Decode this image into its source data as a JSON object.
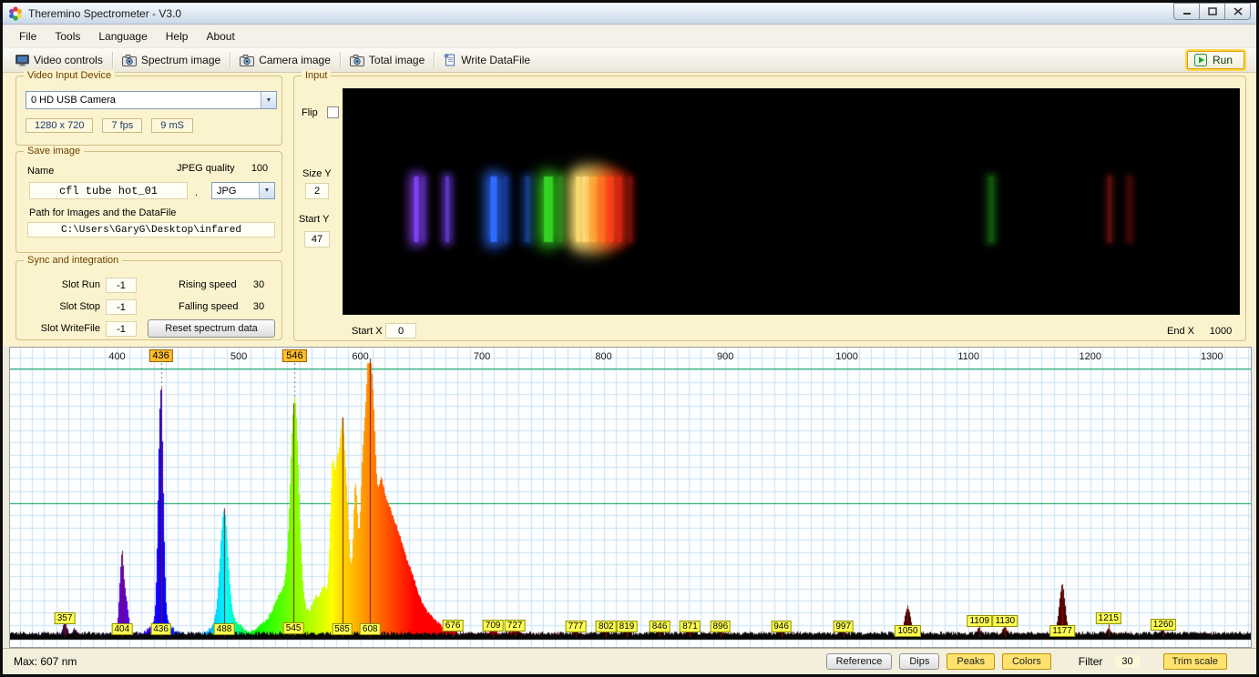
{
  "window": {
    "title": "Theremino Spectrometer - V3.0",
    "controls": [
      "minimize",
      "maximize",
      "close"
    ]
  },
  "menu": {
    "items": [
      "File",
      "Tools",
      "Language",
      "Help",
      "About"
    ]
  },
  "toolbar": {
    "items": [
      {
        "label": "Video controls",
        "icon": "video-controls-icon"
      },
      {
        "label": "Spectrum image",
        "icon": "camera-icon"
      },
      {
        "label": "Camera image",
        "icon": "camera-icon"
      },
      {
        "label": "Total image",
        "icon": "camera-icon"
      },
      {
        "label": "Write DataFile",
        "icon": "write-datafile-icon"
      }
    ],
    "run_label": "Run"
  },
  "video_input": {
    "caption": "Video Input Device",
    "device": "0 HD USB Camera",
    "stats": [
      "1280 x 720",
      "7 fps",
      "9 mS"
    ]
  },
  "save_image": {
    "caption": "Save image",
    "name_label": "Name",
    "name_value": "cfl tube hot_01",
    "separator": ".",
    "format_value": "JPG",
    "jpeg_quality_label": "JPEG quality",
    "jpeg_quality_value": "100",
    "path_label": "Path for Images and the DataFile",
    "path_value": "C:\\Users\\GaryG\\Desktop\\infared"
  },
  "sync": {
    "caption": "Sync and integration",
    "slots": [
      {
        "label": "Slot Run",
        "value": "-1"
      },
      {
        "label": "Slot Stop",
        "value": "-1"
      },
      {
        "label": "Slot WriteFile",
        "value": "-1"
      }
    ],
    "rising_label": "Rising speed",
    "rising_value": "30",
    "falling_label": "Falling speed",
    "falling_value": "30",
    "reset_button": "Reset spectrum data"
  },
  "input_panel": {
    "caption": "Input",
    "flip_label": "Flip",
    "size_y_label": "Size Y",
    "size_y_value": "2",
    "start_y_label": "Start Y",
    "start_y_value": "47",
    "start_x_label": "Start X",
    "start_x_value": "0",
    "end_x_label": "End X",
    "end_x_value": "1000",
    "spectral_lines": [
      {
        "pos": 0.081,
        "w": 5,
        "color": "#8a45ff",
        "glow": 12,
        "o": 0.95
      },
      {
        "pos": 0.09,
        "w": 3,
        "color": "#6a35d8",
        "glow": 7,
        "o": 0.55
      },
      {
        "pos": 0.116,
        "w": 4,
        "color": "#7540f0",
        "glow": 9,
        "o": 0.8
      },
      {
        "pos": 0.168,
        "w": 7,
        "color": "#2e6bff",
        "glow": 14,
        "o": 1
      },
      {
        "pos": 0.181,
        "w": 4,
        "color": "#1d50cc",
        "glow": 8,
        "o": 0.55
      },
      {
        "pos": 0.206,
        "w": 5,
        "color": "#2457e0",
        "glow": 9,
        "o": 0.6
      },
      {
        "pos": 0.229,
        "w": 10,
        "color": "#34d422",
        "glow": 16,
        "o": 1
      },
      {
        "pos": 0.242,
        "w": 5,
        "color": "#2aa51a",
        "glow": 9,
        "o": 0.55
      },
      {
        "pos": 0.262,
        "w": 6,
        "color": "#ffdf45",
        "glow": 14,
        "o": 0.9
      },
      {
        "pos": 0.271,
        "w": 8,
        "color": "#fff2a8",
        "glow": 20,
        "o": 1
      },
      {
        "pos": 0.28,
        "w": 8,
        "color": "#ffc24a",
        "glow": 20,
        "o": 1
      },
      {
        "pos": 0.289,
        "w": 7,
        "color": "#ff8a24",
        "glow": 16,
        "o": 1
      },
      {
        "pos": 0.298,
        "w": 7,
        "color": "#ff4a18",
        "glow": 16,
        "o": 1
      },
      {
        "pos": 0.308,
        "w": 5,
        "color": "#e22512",
        "glow": 11,
        "o": 0.85
      },
      {
        "pos": 0.32,
        "w": 4,
        "color": "#a3150c",
        "glow": 7,
        "o": 0.6
      },
      {
        "pos": 0.723,
        "w": 5,
        "color": "#22a51a",
        "glow": 8,
        "o": 0.5
      },
      {
        "pos": 0.856,
        "w": 4,
        "color": "#b01c1c",
        "glow": 7,
        "o": 0.5
      },
      {
        "pos": 0.878,
        "w": 6,
        "color": "#7d1212",
        "glow": 7,
        "o": 0.45
      }
    ]
  },
  "chart_data": {
    "type": "area",
    "description": "CFL lamp emission spectrum, intensity vs wavelength (nm), rainbow-filled peaks",
    "x_range_nm": [
      312,
      1332
    ],
    "ylim": [
      0,
      1.05
    ],
    "grid": true,
    "grid_nm_step": 10,
    "reference_lines_pct": [
      100,
      50
    ],
    "top_ticks": [
      400,
      500,
      600,
      700,
      800,
      900,
      1000,
      1100,
      1200,
      1300
    ],
    "calibration_ticks": [
      436,
      546
    ],
    "max_peak_nm": 607,
    "peaks": [
      [
        357,
        0.045,
        1.6
      ],
      [
        365,
        0.02,
        1.5
      ],
      [
        404,
        0.3,
        1.8
      ],
      [
        408,
        0.1,
        1.6
      ],
      [
        436,
        0.85,
        2.0
      ],
      [
        436,
        0.06,
        7
      ],
      [
        488,
        0.4,
        3.2
      ],
      [
        488,
        0.06,
        8
      ],
      [
        500,
        0.02,
        6
      ],
      [
        520,
        0.03,
        5
      ],
      [
        533,
        0.1,
        6
      ],
      [
        546,
        0.74,
        3.4
      ],
      [
        546,
        0.13,
        9
      ],
      [
        563,
        0.08,
        3
      ],
      [
        570,
        0.1,
        3
      ],
      [
        577,
        0.5,
        1.8
      ],
      [
        581,
        0.42,
        1.8
      ],
      [
        585,
        0.58,
        2.0
      ],
      [
        589,
        0.35,
        2.2
      ],
      [
        583,
        0.12,
        12
      ],
      [
        596,
        0.48,
        1.8
      ],
      [
        602,
        0.55,
        2.2
      ],
      [
        607,
        0.95,
        2.4
      ],
      [
        611,
        0.5,
        2.0
      ],
      [
        616,
        0.42,
        3.0
      ],
      [
        622,
        0.36,
        4
      ],
      [
        630,
        0.3,
        5
      ],
      [
        640,
        0.2,
        6
      ],
      [
        652,
        0.08,
        7
      ],
      [
        665,
        0.025,
        6
      ],
      [
        676,
        0.035,
        2
      ],
      [
        709,
        0.026,
        2
      ],
      [
        727,
        0.03,
        2
      ],
      [
        777,
        0.016,
        2
      ],
      [
        802,
        0.022,
        2
      ],
      [
        819,
        0.022,
        2
      ],
      [
        846,
        0.02,
        2
      ],
      [
        871,
        0.018,
        2
      ],
      [
        896,
        0.018,
        2
      ],
      [
        946,
        0.016,
        2
      ],
      [
        997,
        0.016,
        2
      ],
      [
        1050,
        0.1,
        2.4
      ],
      [
        1109,
        0.02,
        2
      ],
      [
        1130,
        0.026,
        2
      ],
      [
        1177,
        0.18,
        2.4
      ],
      [
        1215,
        0.018,
        2
      ],
      [
        1260,
        0.014,
        2
      ]
    ],
    "peak_labels": [
      [
        357,
        20
      ],
      [
        404,
        8
      ],
      [
        436,
        8
      ],
      [
        488,
        8
      ],
      [
        545,
        9
      ],
      [
        585,
        8
      ],
      [
        608,
        8
      ],
      [
        676,
        12
      ],
      [
        709,
        12
      ],
      [
        727,
        12
      ],
      [
        777,
        11
      ],
      [
        802,
        11
      ],
      [
        819,
        11
      ],
      [
        846,
        11
      ],
      [
        871,
        11
      ],
      [
        896,
        11
      ],
      [
        946,
        11
      ],
      [
        997,
        11
      ],
      [
        1050,
        6
      ],
      [
        1109,
        17
      ],
      [
        1130,
        17
      ],
      [
        1177,
        6
      ],
      [
        1215,
        20
      ],
      [
        1260,
        13
      ]
    ]
  },
  "statusbar": {
    "max_label": "Max: 607 nm",
    "buttons": [
      {
        "label": "Reference",
        "style": "gray"
      },
      {
        "label": "Dips",
        "style": "gray"
      },
      {
        "label": "Peaks",
        "style": "yellow"
      },
      {
        "label": "Colors",
        "style": "yellow"
      }
    ],
    "filter_label": "Filter",
    "filter_value": "30",
    "trim_button": "Trim scale"
  }
}
